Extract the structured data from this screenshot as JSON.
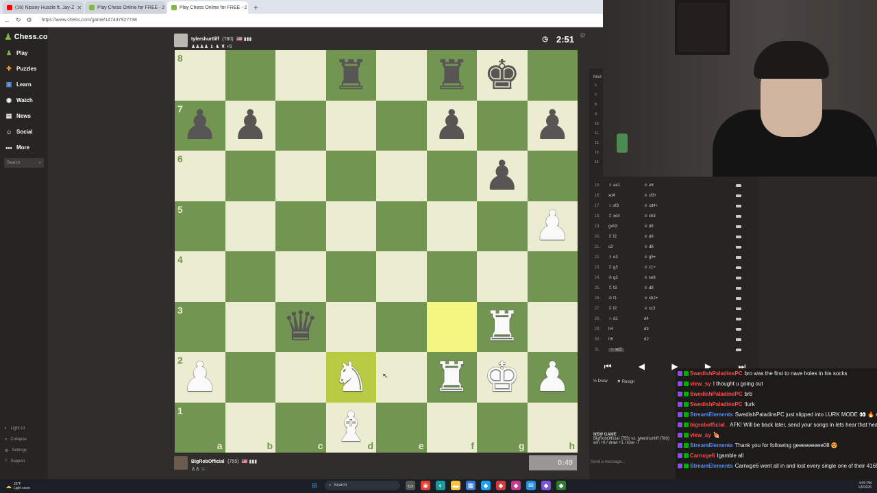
{
  "browser": {
    "tabs": [
      {
        "label": "(16) Nipsey Hussle ft. Jay-Z",
        "color": "#ff0000",
        "active": false
      },
      {
        "label": "Play Chess Online for FREE - 2",
        "color": "#81b64c",
        "active": false
      },
      {
        "label": "Play Chess Online for FREE - 2",
        "color": "#81b64c",
        "active": true
      }
    ],
    "new_tab": "+",
    "url": "https://www.chess.com/game/147437927738"
  },
  "sidebar": {
    "logo": "Chess.com",
    "items": [
      {
        "label": "Play",
        "icon": "play-icon",
        "color": "#81b64c"
      },
      {
        "label": "Puzzles",
        "icon": "puzzle-icon",
        "color": "#f29b36"
      },
      {
        "label": "Learn",
        "icon": "learn-icon",
        "color": "#5d9cec"
      },
      {
        "label": "Watch",
        "icon": "watch-icon",
        "color": "#e6e6e6"
      },
      {
        "label": "News",
        "icon": "news-icon",
        "color": "#e6e6e6"
      },
      {
        "label": "Social",
        "icon": "social-icon",
        "color": "#e6e6e6"
      },
      {
        "label": "More",
        "icon": "more-icon",
        "color": "#e6e6e6"
      }
    ],
    "search_placeholder": "Search",
    "bottom": [
      "Light UI",
      "Collapse",
      "Settings",
      "Support"
    ]
  },
  "game": {
    "top_player": {
      "name": "tylershurtliff",
      "rating": "(780)",
      "flags": "🇺🇸 ▮▮▮",
      "captured": "♟♟♟♟ ♝ ♞ ♜ +5"
    },
    "bottom_player": {
      "name": "BigRobOfficial",
      "rating": "(755)",
      "flags": "🇺🇸 ▮▮▮",
      "captured": "♙♙ ♘"
    },
    "top_clock": "2:51",
    "bottom_clock": "0:49",
    "files": [
      "a",
      "b",
      "c",
      "d",
      "e",
      "f",
      "g",
      "h"
    ],
    "ranks": [
      "8",
      "7",
      "6",
      "5",
      "4",
      "3",
      "2",
      "1"
    ],
    "light_color": "#ebecd0",
    "dark_color": "#739552",
    "highlight_light": "#f5f682",
    "highlight_dark": "#b9ca43",
    "pieces": [
      {
        "sq": "d8",
        "glyph": "♜",
        "side": "b"
      },
      {
        "sq": "f8",
        "glyph": "♜",
        "side": "b"
      },
      {
        "sq": "g8",
        "glyph": "♚",
        "side": "b"
      },
      {
        "sq": "a7",
        "glyph": "♟",
        "side": "b"
      },
      {
        "sq": "b7",
        "glyph": "♟",
        "side": "b"
      },
      {
        "sq": "f7",
        "glyph": "♟",
        "side": "b"
      },
      {
        "sq": "h7",
        "glyph": "♟",
        "side": "b"
      },
      {
        "sq": "g6",
        "glyph": "♟",
        "side": "b"
      },
      {
        "sq": "h5",
        "glyph": "♟",
        "side": "w"
      },
      {
        "sq": "c3",
        "glyph": "♛",
        "side": "b"
      },
      {
        "sq": "g3",
        "glyph": "♜",
        "side": "w"
      },
      {
        "sq": "a2",
        "glyph": "♟",
        "side": "w"
      },
      {
        "sq": "d2",
        "glyph": "♞",
        "side": "w"
      },
      {
        "sq": "f2",
        "glyph": "♜",
        "side": "w"
      },
      {
        "sq": "g2",
        "glyph": "♚",
        "side": "w"
      },
      {
        "sq": "h2",
        "glyph": "♟",
        "side": "w"
      },
      {
        "sq": "d1",
        "glyph": "♝",
        "side": "w"
      }
    ],
    "highlights": [
      "f3",
      "d2"
    ]
  },
  "stream": {
    "mod_label": "Mod",
    "mod_lines": [
      "6.",
      "7.",
      "8.",
      "9.",
      "10.",
      "11.",
      "12.",
      "13.",
      "14."
    ]
  },
  "moves": [
    {
      "no": "15.",
      "w": "♗ ae1",
      "b": "♕ e5"
    },
    {
      "no": "16.",
      "w": "xd4",
      "b": "♕ xf3+"
    },
    {
      "no": "17.",
      "w": "♘ xf3",
      "b": "♕ xd4+"
    },
    {
      "no": "18.",
      "w": "♖ xd4",
      "b": "♕ xh3"
    },
    {
      "no": "19.",
      "w": "gxh3",
      "b": "♕ d8"
    },
    {
      "no": "20.",
      "w": "♖ f2",
      "b": "♕ b6"
    },
    {
      "no": "21.",
      "w": "c3",
      "b": "♕ d8"
    },
    {
      "no": "22.",
      "w": "♗ e3",
      "b": "♕ g5+"
    },
    {
      "no": "23.",
      "w": "♖ g3",
      "b": "♕ c1+"
    },
    {
      "no": "24.",
      "w": "♔ g2",
      "b": "♕ xe8"
    },
    {
      "no": "25.",
      "w": "♖ f3",
      "b": "♕ d8"
    },
    {
      "no": "26.",
      "w": "♔ f1",
      "b": "♕ xb2+"
    },
    {
      "no": "27.",
      "w": "♖ f2",
      "b": "♕ xc3"
    },
    {
      "no": "28.",
      "w": "♘ d1",
      "b": "d4"
    },
    {
      "no": "29.",
      "w": "h4",
      "b": "d3"
    },
    {
      "no": "30.",
      "w": "h5",
      "b": "d2"
    },
    {
      "no": "31.",
      "w": "♘ xd2",
      "b": ""
    }
  ],
  "controls": {
    "first": "⏮",
    "prev": "◀",
    "play": "▶",
    "next": "▶",
    "last": "⏭"
  },
  "actions": {
    "draw": "½ Draw",
    "resign": "⚑ Resign"
  },
  "new_game": {
    "title": "NEW GAME",
    "line1": "BigRobOfficial (755) vs. tylershurtliff (780)",
    "line2": "win +9 / draw +1 / lose -7"
  },
  "send_message": "Send a message...",
  "chat": [
    {
      "user": "SwedishPaladinsPC",
      "color": "#ff4b4b",
      "msg": "bro was the first to nave holes in his socks"
    },
    {
      "user": "view_sy",
      "color": "#ff4b4b",
      "msg": "I thought u going out"
    },
    {
      "user": "SwedishPaladinsPC",
      "color": "#ff4b4b",
      "msg": "brb"
    },
    {
      "user": "SwedishPaladinsPC",
      "color": "#ff4b4b",
      "msg": "!lurk"
    },
    {
      "user": "StreamElements",
      "color": "#5b8def",
      "msg": "SwedishPaladinsPC just slipped into LURK MODE 👀 🔥 Appreciate you holding it down! Enjoy the stream!"
    },
    {
      "user": "bigrobofficial_",
      "color": "#ff4b4b",
      "msg": "AFK! Will be back later, send your songs in lets hear that heat!"
    },
    {
      "user": "view_sy",
      "color": "#ff4b4b",
      "msg": "🍖"
    },
    {
      "user": "StreamElements",
      "color": "#5b8def",
      "msg": "Thank you for following geeeeeeeee08 😍"
    },
    {
      "user": "Carnxge6",
      "color": "#ff4b4b",
      "msg": "Igamble all"
    },
    {
      "user": "StreamElements",
      "color": "#5b8def",
      "msg": "Carnxge6 went all in and lost every single one of their 4165 points 😱"
    }
  ],
  "taskbar": {
    "weather_temp": "25°F",
    "weather_text": "Light snow",
    "search": "Search",
    "time": "4:09 PM",
    "date": "1/5/2025"
  }
}
